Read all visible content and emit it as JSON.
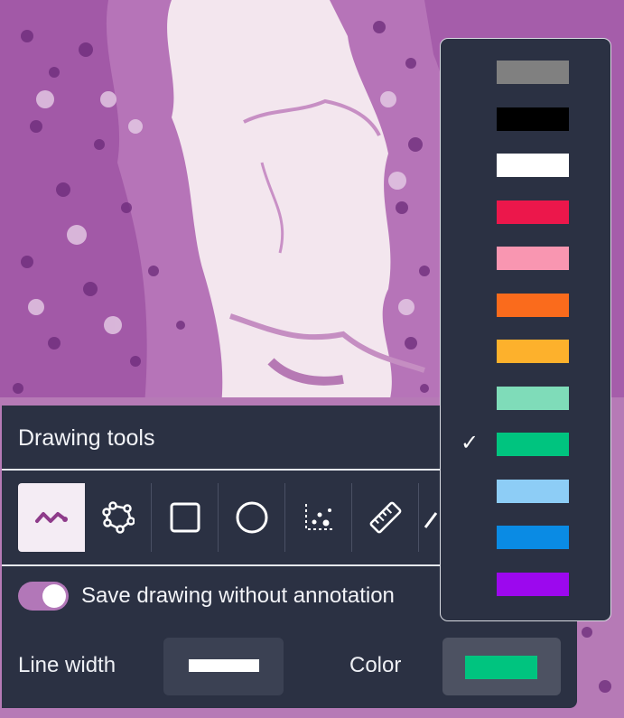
{
  "panel": {
    "title": "Drawing tools",
    "tools": [
      {
        "name": "freehand",
        "icon": "freehand-wave-icon",
        "selected": true
      },
      {
        "name": "polygon",
        "icon": "polygon-icon",
        "selected": false
      },
      {
        "name": "rectangle",
        "icon": "rectangle-icon",
        "selected": false
      },
      {
        "name": "ellipse",
        "icon": "circle-icon",
        "selected": false
      },
      {
        "name": "points",
        "icon": "points-icon",
        "selected": false
      },
      {
        "name": "measure",
        "icon": "ruler-icon",
        "selected": false
      },
      {
        "name": "more",
        "icon": "partial-tool-icon",
        "selected": false
      }
    ],
    "save_toggle": {
      "label": "Save drawing without annotation",
      "on": true
    },
    "line_width_label": "Line width",
    "color_label": "Color",
    "current_color": "#00c47f"
  },
  "color_dropdown": {
    "options": [
      {
        "color": "#808080",
        "selected": false
      },
      {
        "color": "#000000",
        "selected": false
      },
      {
        "color": "#ffffff",
        "selected": false
      },
      {
        "color": "#ec174b",
        "selected": false
      },
      {
        "color": "#f996b1",
        "selected": false
      },
      {
        "color": "#fa6b1c",
        "selected": false
      },
      {
        "color": "#fdb12c",
        "selected": false
      },
      {
        "color": "#7fdcb9",
        "selected": false
      },
      {
        "color": "#00c47f",
        "selected": true
      },
      {
        "color": "#8dcdf6",
        "selected": false
      },
      {
        "color": "#0a8be4",
        "selected": false
      },
      {
        "color": "#9c08ee",
        "selected": false
      }
    ],
    "check_glyph": "✓"
  },
  "colors": {
    "panel_bg": "#2b3143",
    "toggle_on": "#b277b8",
    "accent": "#8e3b8a"
  }
}
